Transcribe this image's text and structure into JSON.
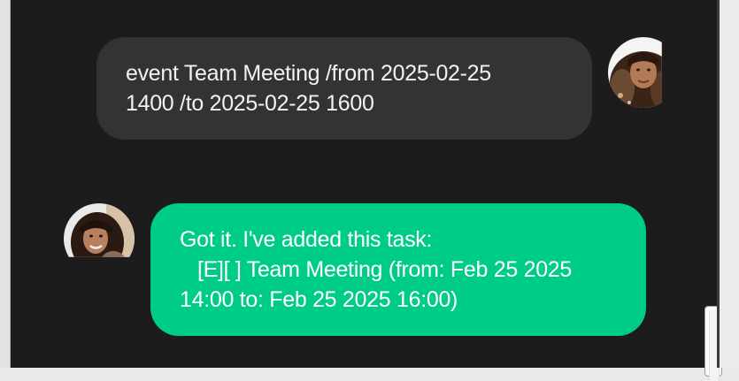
{
  "chat": {
    "messages": [
      {
        "sender": "user",
        "text": "event Team Meeting /from 2025-02-25\n1400 /to 2025-02-25 1600"
      },
      {
        "sender": "bot",
        "text": "Got it. I've added this task:\n   [E][ ] Team Meeting (from: Feb 25 2025\n14:00 to: Feb 25 2025 16:00)"
      }
    ]
  },
  "colors": {
    "background": "#1c1c1c",
    "user_bubble": "#333333",
    "bot_bubble": "#00cc8a",
    "text": "#ffffff"
  },
  "icons": {
    "close": "close-icon",
    "user_avatar": "user-avatar-photo",
    "bot_avatar": "bot-avatar-photo"
  }
}
